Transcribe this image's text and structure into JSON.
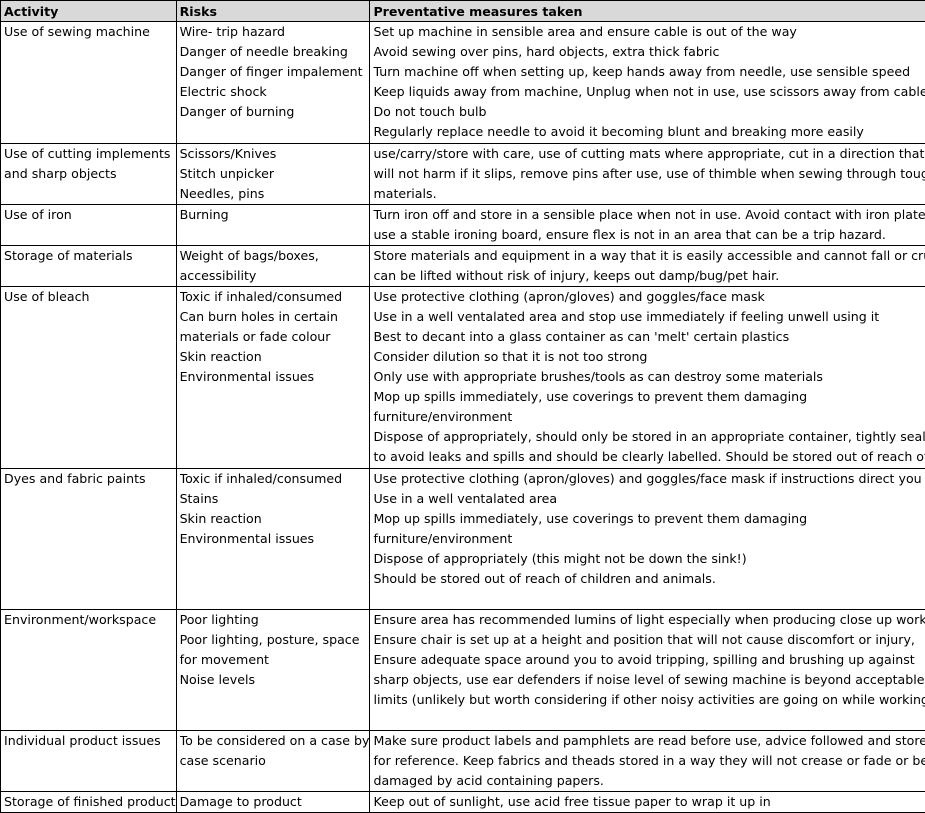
{
  "headers": [
    "Activity",
    "Risks",
    "Preventative measures taken"
  ],
  "rows": [
    {
      "activity": [
        "Use of sewing machine"
      ],
      "risks": [
        "Wire- trip hazard",
        "Danger of needle breaking",
        "Danger of finger impalement",
        "Electric shock",
        "Danger of burning"
      ],
      "measures": [
        "Set up machine in sensible area and ensure cable is out of the way",
        "Avoid sewing over pins, hard objects, extra thick fabric",
        "Turn machine off when setting up, keep hands away from needle, use sensible speed",
        "Keep liquids away from machine, Unplug when not in use, use scissors away from cable",
        "Do not touch bulb",
        "Regularly replace needle to avoid it becoming blunt and breaking more easily"
      ]
    },
    {
      "activity": [
        "Use of cutting implements",
        "and sharp objects"
      ],
      "risks": [
        "Scissors/Knives",
        "Stitch unpicker",
        "Needles, pins"
      ],
      "measures": [
        "use/carry/store with care, use of cutting mats where appropriate, cut in a direction that",
        "will not harm if it slips, remove pins after use, use of thimble when sewing through tough",
        "materials."
      ]
    },
    {
      "activity": [
        "Use of iron"
      ],
      "risks": [
        "Burning"
      ],
      "measures": [
        "Turn iron off and store in a sensible place when not in use. Avoid contact with iron plate,",
        "use a stable ironing board, ensure flex is not in an area that can be a trip hazard."
      ]
    },
    {
      "activity": [
        "Storage of materials"
      ],
      "risks": [
        "Weight of bags/boxes,",
        "accessibility"
      ],
      "measures": [
        "Store materials and equipment in a way that it is easily accessible and cannot fall or crush,",
        "can be lifted without risk of injury, keeps out damp/bug/pet hair."
      ]
    },
    {
      "activity": [
        "Use of bleach"
      ],
      "risks": [
        "Toxic if inhaled/consumed",
        "Can burn holes in certain",
        "materials or fade colour",
        "Skin reaction",
        "Environmental issues"
      ],
      "measures": [
        "Use protective clothing (apron/gloves) and goggles/face mask",
        "Use in a well ventalated area and stop use immediately if feeling unwell using it",
        "Best to decant into a glass container as can 'melt' certain plastics",
        "Consider dilution so that it is not too strong",
        "Only use with appropriate brushes/tools as can destroy some materials",
        "Mop up spills immediately, use coverings to prevent them damaging",
        "furniture/environment",
        "Dispose of appropriately, should only be stored in an appropriate container, tightly sealed",
        "to avoid leaks and spills and should be clearly labelled. Should be stored out of reach of"
      ]
    },
    {
      "activity": [
        "Dyes and fabric paints"
      ],
      "risks": [
        "Toxic if inhaled/consumed",
        "Stains",
        "Skin reaction",
        "Environmental issues"
      ],
      "measures": [
        "Use protective clothing (apron/gloves) and goggles/face mask if instructions direct you to",
        "Use in a well ventalated area",
        "Mop up spills immediately, use coverings to prevent them damaging",
        "furniture/environment",
        "Dispose of appropriately (this might not be down the sink!)",
        "Should be stored out of reach of children and animals."
      ]
    },
    {
      "activity": [
        "Environment/workspace"
      ],
      "risks": [
        "Poor lighting",
        "Poor lighting, posture, space",
        "for movement",
        "Noise levels"
      ],
      "measures": [
        "Ensure area has recommended lumins of light especially when producing close up work,",
        "Ensure chair is set up at a height and position that will not cause discomfort or injury,",
        "Ensure adequate space around you to avoid tripping, spilling and brushing up against",
        "sharp objects, use ear defenders if noise level of sewing machine is beyond acceptable",
        "limits (unlikely but worth considering if other noisy activities are going on while working!)"
      ]
    },
    {
      "activity": [
        "Individual product issues"
      ],
      "risks": [
        "To be considered on a case by",
        "case scenario"
      ],
      "measures": [
        "Make sure product labels and pamphlets are read before use, advice followed and stored",
        "for reference. Keep fabrics and theads stored in a way they will not crease or fade or be",
        "damaged by acid containing papers."
      ]
    },
    {
      "activity": [
        "Storage of finished product"
      ],
      "risks": [
        "Damage to product"
      ],
      "measures": [
        "Keep out of sunlight, use acid free tissue paper to wrap it up in"
      ]
    }
  ]
}
